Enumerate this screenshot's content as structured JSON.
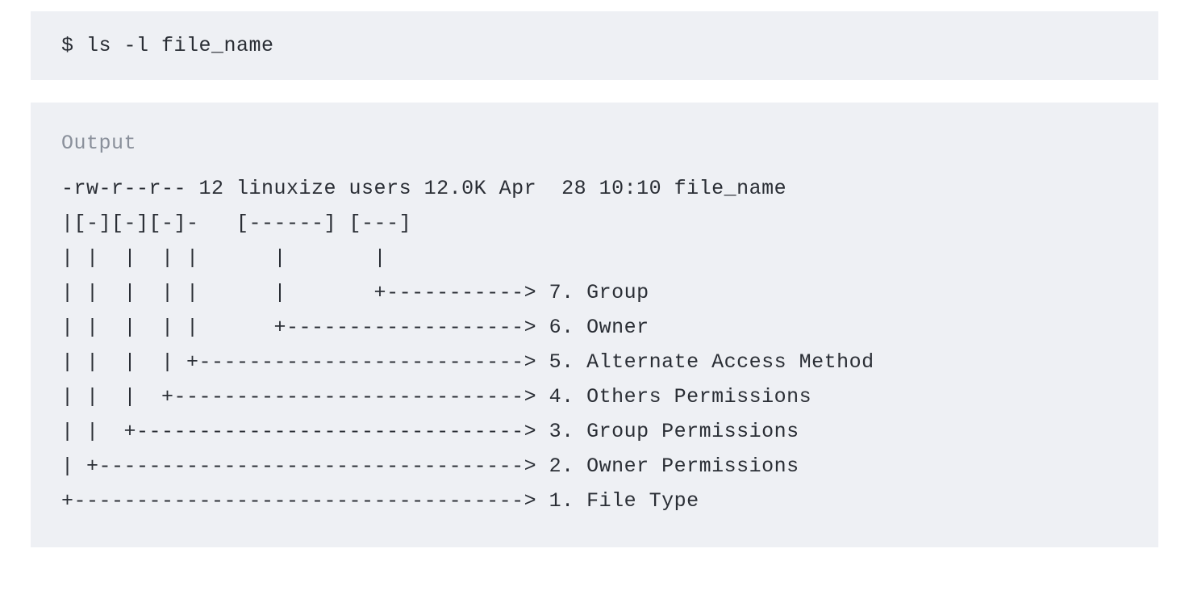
{
  "command": {
    "prompt": "$ ",
    "text": "ls -l file_name"
  },
  "output": {
    "label": "Output",
    "lines": [
      "-rw-r--r-- 12 linuxize users 12.0K Apr  28 10:10 file_name",
      "|[-][-][-]-   [------] [---]",
      "| |  |  | |      |       |",
      "| |  |  | |      |       +-----------> 7. Group",
      "| |  |  | |      +-------------------> 6. Owner",
      "| |  |  | +--------------------------> 5. Alternate Access Method",
      "| |  |  +----------------------------> 4. Others Permissions",
      "| |  +-------------------------------> 3. Group Permissions",
      "| +----------------------------------> 2. Owner Permissions",
      "+------------------------------------> 1. File Type"
    ]
  }
}
